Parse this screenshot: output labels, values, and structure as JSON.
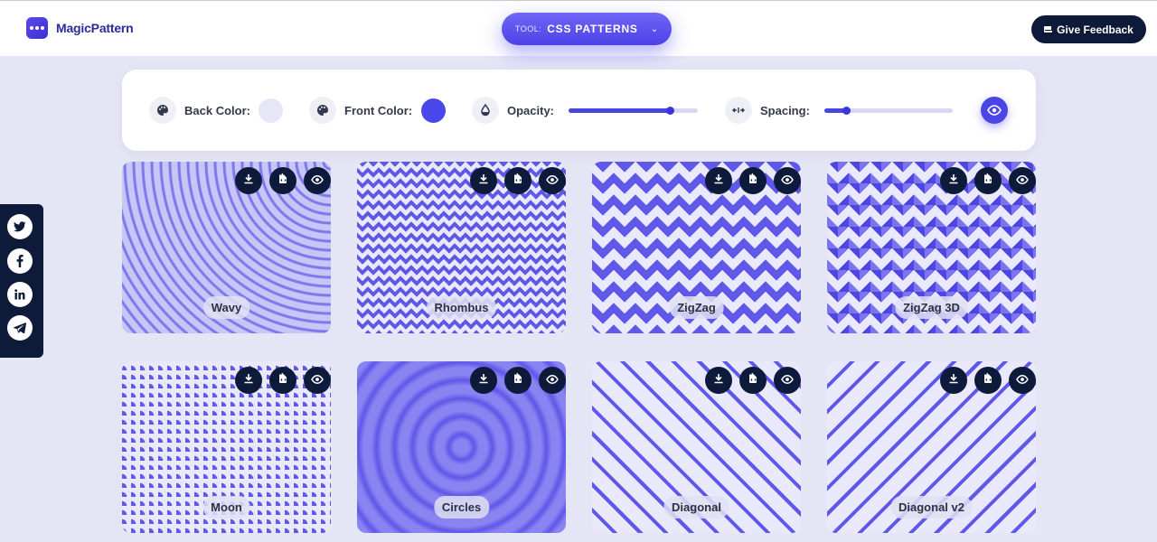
{
  "brand": {
    "name": "MagicPattern"
  },
  "tool": {
    "prefix": "TOOL:",
    "value": "CSS PATTERNS"
  },
  "feedback": {
    "label": "Give Feedback"
  },
  "controls": {
    "back_color_label": "Back Color:",
    "back_color": "#e6e6f6",
    "front_color_label": "Front Color:",
    "front_color": "#4a47ea",
    "opacity_label": "Opacity:",
    "opacity_value": 0.78,
    "spacing_label": "Spacing:",
    "spacing_value": 0.17
  },
  "social": [
    "twitter-icon",
    "facebook-icon",
    "linkedin-icon",
    "telegram-icon"
  ],
  "patterns": [
    {
      "label": "Wavy"
    },
    {
      "label": "Rhombus"
    },
    {
      "label": "ZigZag"
    },
    {
      "label": "ZigZag 3D"
    },
    {
      "label": "Moon"
    },
    {
      "label": "Circles"
    },
    {
      "label": "Diagonal"
    },
    {
      "label": "Diagonal v2"
    }
  ],
  "colors": {
    "accent": "#4b45e6",
    "dark": "#0e1a3a",
    "background": "#e5e6f5"
  }
}
